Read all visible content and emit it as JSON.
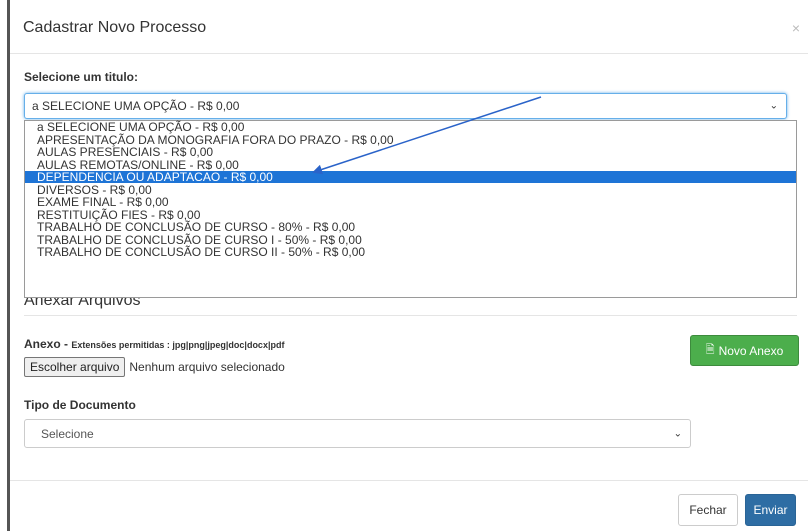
{
  "modal": {
    "title": "Cadastrar Novo Processo",
    "close_glyph": "×"
  },
  "titulo": {
    "label": "Selecione um titulo:",
    "selected": "a SELECIONE UMA OPÇÃO - R$ 0,00",
    "options": [
      "a SELECIONE UMA OPÇÃO - R$ 0,00",
      "APRESENTAÇÃO DA MONOGRAFIA FORA DO PRAZO - R$ 0,00",
      "AULAS PRESENCIAIS - R$ 0,00",
      "AULAS REMOTAS/ONLINE - R$ 0,00",
      "DEPENDENCIA OU ADAPTACAO - R$ 0,00",
      "DIVERSOS - R$ 0,00",
      "EXAME FINAL - R$ 0,00",
      "RESTITUIÇÃO FIES - R$ 0,00",
      "TRABALHO DE CONCLUSÃO DE CURSO - 80% - R$ 0,00",
      "TRABALHO DE CONCLUSÃO DE CURSO I - 50% - R$ 0,00",
      "TRABALHO DE CONCLUSÃO DE CURSO II - 50% - R$ 0,00"
    ],
    "highlighted_option": "DEPENDENCIA OU ADAPTACAO - R$ 0,00"
  },
  "anexar": {
    "section_title": "Anexar Arquivos",
    "anexo_label": "Anexo - ",
    "extensions": "Extensões permitidas : jpg|png|jpeg|doc|docx|pdf",
    "file_button": "Escolher arquivo",
    "file_status": "Nenhum arquivo selecionado",
    "new_attachment_button": "Novo Anexo",
    "new_attachment_icon": "file-icon"
  },
  "tipo_documento": {
    "label": "Tipo de Documento",
    "selected": "Selecione"
  },
  "footer": {
    "close_button": "Fechar",
    "submit_button": "Enviar"
  },
  "colors": {
    "highlight": "#1e74d6",
    "success": "#4cae4c",
    "primary": "#2e6da4",
    "arrow": "#2a63c9"
  }
}
